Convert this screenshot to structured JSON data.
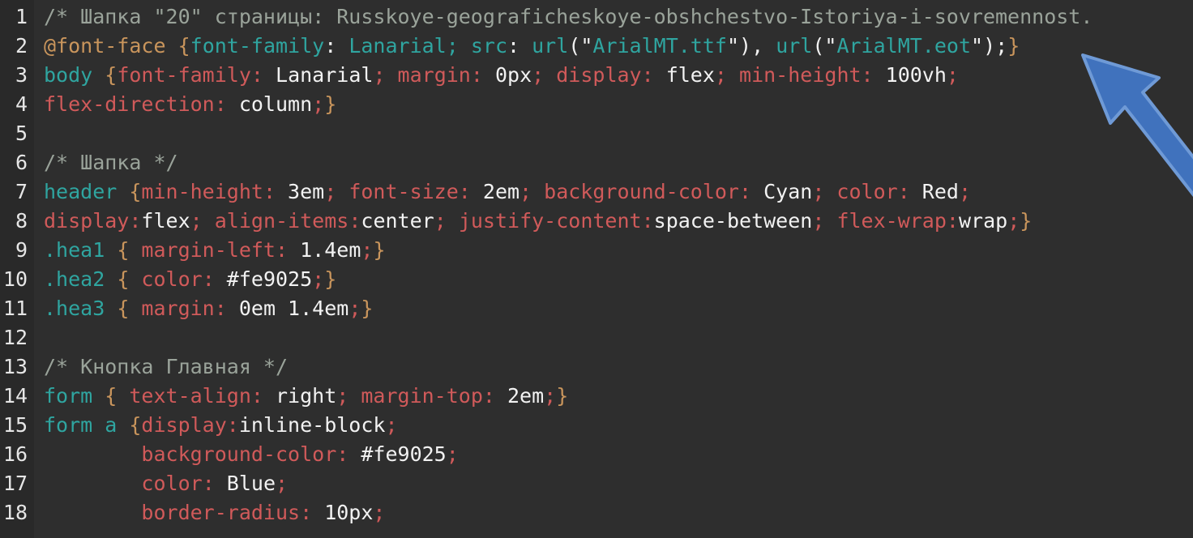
{
  "editor": {
    "theme_background": "#2e2e2e",
    "gutter_background": "#292929",
    "line_number_color": "#e6e6e6",
    "colors": {
      "comment": "#9aa39a",
      "at_rule": "#c9955c",
      "selector": "#2fa5a0",
      "brace": "#c9955c",
      "property": "#d05a5a",
      "value": "#f2f2f2",
      "string_teal": "#2fa5a0",
      "cursor_blue": "#4a7ec4"
    },
    "first_visible_line": 1,
    "last_visible_line": 18,
    "language": "CSS"
  },
  "cursor": {
    "icon": "mouse-pointer-arrow-icon",
    "color": "#4a7ec4",
    "border_color": "#6f9ad6",
    "points_at": "closing brace of @font-face rule on line 2"
  },
  "lines": [
    {
      "number": "1",
      "tokens": [
        {
          "c": "t-comment",
          "t": "/* Шапка \"20\" страницы: Russkoye-geograficheskoye-obshchestvo-Istoriya-i-sovremennost."
        }
      ]
    },
    {
      "number": "2",
      "tokens": [
        {
          "c": "t-atrule",
          "t": "@font-face "
        },
        {
          "c": "t-brace",
          "t": "{"
        },
        {
          "c": "t-propteal",
          "t": "font-family"
        },
        {
          "c": "t-value",
          "t": ": "
        },
        {
          "c": "t-valteal",
          "t": "Lanarial"
        },
        {
          "c": "t-valteal",
          "t": "; "
        },
        {
          "c": "t-propteal",
          "t": "src"
        },
        {
          "c": "t-value",
          "t": ": "
        },
        {
          "c": "t-valteal",
          "t": "url"
        },
        {
          "c": "t-value",
          "t": "(\""
        },
        {
          "c": "t-valteal",
          "t": "ArialMT.ttf"
        },
        {
          "c": "t-value",
          "t": "\"), "
        },
        {
          "c": "t-valteal",
          "t": "url"
        },
        {
          "c": "t-value",
          "t": "(\""
        },
        {
          "c": "t-valteal",
          "t": "ArialMT.eot"
        },
        {
          "c": "t-value",
          "t": "\");"
        },
        {
          "c": "t-brace",
          "t": "}"
        }
      ]
    },
    {
      "number": "3",
      "tokens": [
        {
          "c": "t-selector",
          "t": "body "
        },
        {
          "c": "t-brace",
          "t": "{"
        },
        {
          "c": "t-prop",
          "t": "font-family"
        },
        {
          "c": "t-prop",
          "t": ": "
        },
        {
          "c": "t-value",
          "t": "Lanarial"
        },
        {
          "c": "t-punct",
          "t": "; "
        },
        {
          "c": "t-prop",
          "t": "margin"
        },
        {
          "c": "t-prop",
          "t": ": "
        },
        {
          "c": "t-value",
          "t": "0px"
        },
        {
          "c": "t-punct",
          "t": "; "
        },
        {
          "c": "t-prop",
          "t": "display"
        },
        {
          "c": "t-prop",
          "t": ": "
        },
        {
          "c": "t-value",
          "t": "flex"
        },
        {
          "c": "t-punct",
          "t": "; "
        },
        {
          "c": "t-prop",
          "t": "min-height"
        },
        {
          "c": "t-prop",
          "t": ": "
        },
        {
          "c": "t-value",
          "t": "100vh"
        },
        {
          "c": "t-punct",
          "t": ";"
        }
      ]
    },
    {
      "number": "4",
      "tokens": [
        {
          "c": "t-prop",
          "t": "flex-direction"
        },
        {
          "c": "t-prop",
          "t": ": "
        },
        {
          "c": "t-value",
          "t": "column"
        },
        {
          "c": "t-punct",
          "t": ";"
        },
        {
          "c": "t-brace",
          "t": "}"
        }
      ]
    },
    {
      "number": "5",
      "tokens": []
    },
    {
      "number": "6",
      "tokens": [
        {
          "c": "t-comment",
          "t": "/* Шапка */"
        }
      ]
    },
    {
      "number": "7",
      "tokens": [
        {
          "c": "t-selector",
          "t": "header "
        },
        {
          "c": "t-brace",
          "t": "{"
        },
        {
          "c": "t-prop",
          "t": "min-height"
        },
        {
          "c": "t-prop",
          "t": ": "
        },
        {
          "c": "t-value",
          "t": "3em"
        },
        {
          "c": "t-punct",
          "t": "; "
        },
        {
          "c": "t-prop",
          "t": "font-size"
        },
        {
          "c": "t-prop",
          "t": ": "
        },
        {
          "c": "t-value",
          "t": "2em"
        },
        {
          "c": "t-punct",
          "t": "; "
        },
        {
          "c": "t-prop",
          "t": "background-color"
        },
        {
          "c": "t-prop",
          "t": ": "
        },
        {
          "c": "t-value",
          "t": "Cyan"
        },
        {
          "c": "t-punct",
          "t": "; "
        },
        {
          "c": "t-prop",
          "t": "color"
        },
        {
          "c": "t-prop",
          "t": ": "
        },
        {
          "c": "t-value",
          "t": "Red"
        },
        {
          "c": "t-punct",
          "t": ";"
        }
      ]
    },
    {
      "number": "8",
      "tokens": [
        {
          "c": "t-prop",
          "t": "display"
        },
        {
          "c": "t-prop",
          "t": ":"
        },
        {
          "c": "t-value",
          "t": "flex"
        },
        {
          "c": "t-punct",
          "t": "; "
        },
        {
          "c": "t-prop",
          "t": "align-items"
        },
        {
          "c": "t-prop",
          "t": ":"
        },
        {
          "c": "t-value",
          "t": "center"
        },
        {
          "c": "t-punct",
          "t": "; "
        },
        {
          "c": "t-prop",
          "t": "justify-content"
        },
        {
          "c": "t-prop",
          "t": ":"
        },
        {
          "c": "t-value",
          "t": "space-between"
        },
        {
          "c": "t-punct",
          "t": "; "
        },
        {
          "c": "t-prop",
          "t": "flex-wrap"
        },
        {
          "c": "t-prop",
          "t": ":"
        },
        {
          "c": "t-value",
          "t": "wrap"
        },
        {
          "c": "t-punct",
          "t": ";"
        },
        {
          "c": "t-brace",
          "t": "}"
        }
      ]
    },
    {
      "number": "9",
      "tokens": [
        {
          "c": "t-selector",
          "t": ".hea1 "
        },
        {
          "c": "t-brace",
          "t": "{ "
        },
        {
          "c": "t-prop",
          "t": "margin-left"
        },
        {
          "c": "t-prop",
          "t": ": "
        },
        {
          "c": "t-value",
          "t": "1.4em"
        },
        {
          "c": "t-punct",
          "t": ";"
        },
        {
          "c": "t-brace",
          "t": "}"
        }
      ]
    },
    {
      "number": "10",
      "tokens": [
        {
          "c": "t-selector",
          "t": ".hea2 "
        },
        {
          "c": "t-brace",
          "t": "{ "
        },
        {
          "c": "t-prop",
          "t": "color"
        },
        {
          "c": "t-prop",
          "t": ": "
        },
        {
          "c": "t-value",
          "t": "#fe9025"
        },
        {
          "c": "t-punct",
          "t": ";"
        },
        {
          "c": "t-brace",
          "t": "}"
        }
      ]
    },
    {
      "number": "11",
      "tokens": [
        {
          "c": "t-selector",
          "t": ".hea3 "
        },
        {
          "c": "t-brace",
          "t": "{ "
        },
        {
          "c": "t-prop",
          "t": "margin"
        },
        {
          "c": "t-prop",
          "t": ": "
        },
        {
          "c": "t-value",
          "t": "0em 1.4em"
        },
        {
          "c": "t-punct",
          "t": ";"
        },
        {
          "c": "t-brace",
          "t": "}"
        }
      ]
    },
    {
      "number": "12",
      "tokens": []
    },
    {
      "number": "13",
      "tokens": [
        {
          "c": "t-comment",
          "t": "/* Кнопка Главная */"
        }
      ]
    },
    {
      "number": "14",
      "tokens": [
        {
          "c": "t-selector",
          "t": "form "
        },
        {
          "c": "t-brace",
          "t": "{ "
        },
        {
          "c": "t-prop",
          "t": "text-align"
        },
        {
          "c": "t-prop",
          "t": ": "
        },
        {
          "c": "t-value",
          "t": "right"
        },
        {
          "c": "t-punct",
          "t": "; "
        },
        {
          "c": "t-prop",
          "t": "margin-top"
        },
        {
          "c": "t-prop",
          "t": ": "
        },
        {
          "c": "t-value",
          "t": "2em"
        },
        {
          "c": "t-punct",
          "t": ";"
        },
        {
          "c": "t-brace",
          "t": "}"
        }
      ]
    },
    {
      "number": "15",
      "tokens": [
        {
          "c": "t-selector",
          "t": "form a "
        },
        {
          "c": "t-brace",
          "t": "{"
        },
        {
          "c": "t-prop",
          "t": "display"
        },
        {
          "c": "t-prop",
          "t": ":"
        },
        {
          "c": "t-value",
          "t": "inline-block"
        },
        {
          "c": "t-punct",
          "t": ";"
        }
      ]
    },
    {
      "number": "16",
      "tokens": [
        {
          "c": "t-plain",
          "t": "        "
        },
        {
          "c": "t-prop",
          "t": "background-color"
        },
        {
          "c": "t-prop",
          "t": ": "
        },
        {
          "c": "t-value",
          "t": "#fe9025"
        },
        {
          "c": "t-punct",
          "t": ";"
        }
      ]
    },
    {
      "number": "17",
      "tokens": [
        {
          "c": "t-plain",
          "t": "        "
        },
        {
          "c": "t-prop",
          "t": "color"
        },
        {
          "c": "t-prop",
          "t": ": "
        },
        {
          "c": "t-value",
          "t": "Blue"
        },
        {
          "c": "t-punct",
          "t": ";"
        }
      ]
    },
    {
      "number": "18",
      "tokens": [
        {
          "c": "t-plain",
          "t": "        "
        },
        {
          "c": "t-prop",
          "t": "border-radius"
        },
        {
          "c": "t-prop",
          "t": ": "
        },
        {
          "c": "t-value",
          "t": "10px"
        },
        {
          "c": "t-punct",
          "t": ";"
        }
      ]
    }
  ]
}
